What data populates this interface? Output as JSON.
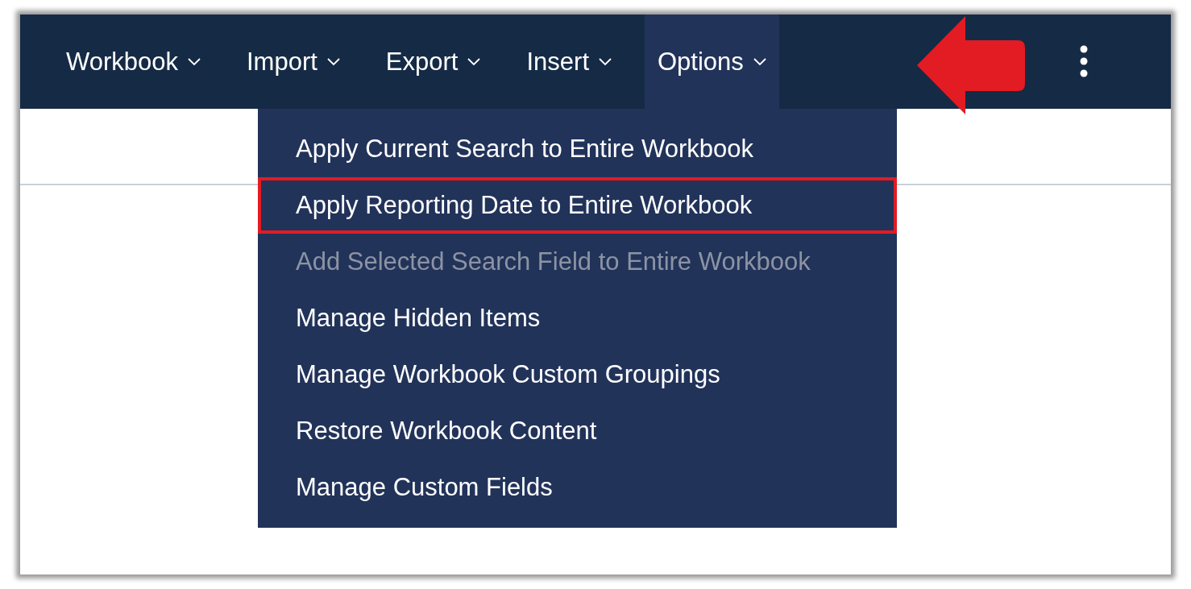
{
  "nav": {
    "items": [
      {
        "label": "Workbook",
        "selected": false
      },
      {
        "label": "Import",
        "selected": false
      },
      {
        "label": "Export",
        "selected": false
      },
      {
        "label": "Insert",
        "selected": false
      },
      {
        "label": "Options",
        "selected": true
      }
    ]
  },
  "menu": {
    "items": [
      {
        "label": "Apply Current Search to Entire Workbook",
        "disabled": false,
        "highlighted": false
      },
      {
        "label": "Apply Reporting Date to Entire Workbook",
        "disabled": false,
        "highlighted": true
      },
      {
        "label": "Add Selected Search Field to Entire Workbook",
        "disabled": true,
        "highlighted": false
      },
      {
        "label": "Manage Hidden Items",
        "disabled": false,
        "highlighted": false
      },
      {
        "label": "Manage Workbook Custom Groupings",
        "disabled": false,
        "highlighted": false
      },
      {
        "label": "Restore Workbook Content",
        "disabled": false,
        "highlighted": false
      },
      {
        "label": "Manage Custom Fields",
        "disabled": false,
        "highlighted": false
      }
    ]
  }
}
